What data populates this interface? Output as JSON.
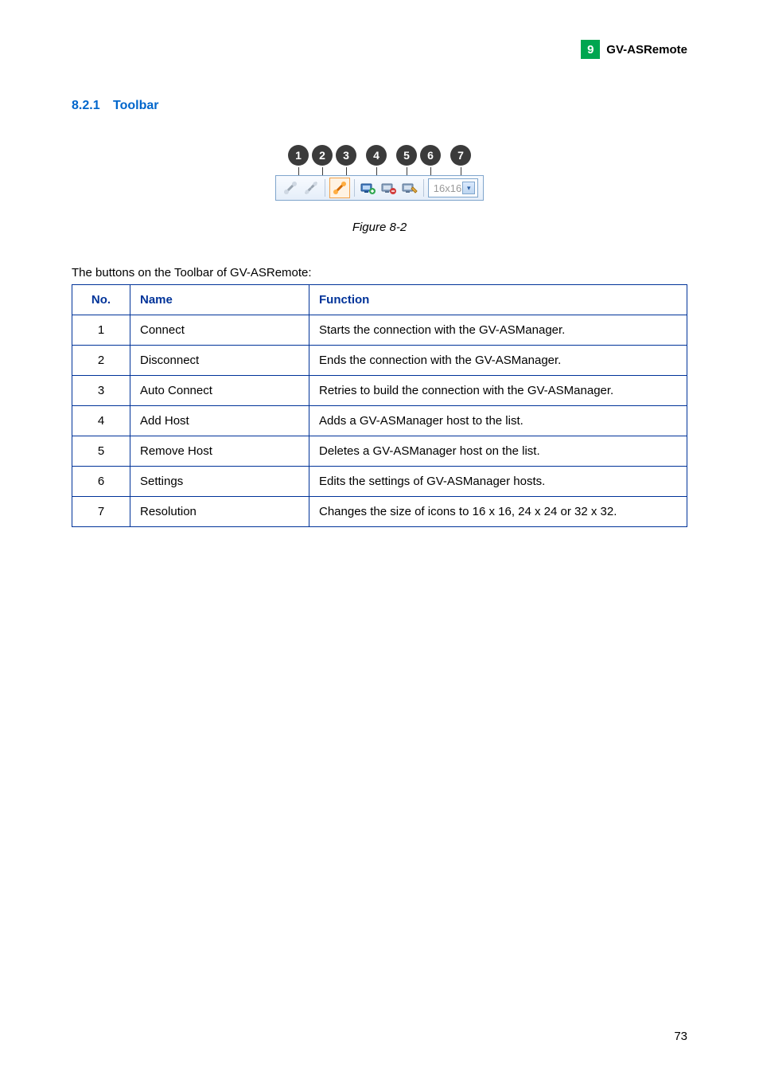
{
  "header": {
    "badge": "9",
    "title": "GV-ASRemote"
  },
  "section": {
    "number": "8.2.1",
    "title": "Toolbar"
  },
  "toolbar": {
    "callouts": [
      "1",
      "2",
      "3",
      "4",
      "5",
      "6",
      "7"
    ],
    "resolution_value": "16x16"
  },
  "figure_caption": "Figure 8-2",
  "table_intro": "The buttons on the Toolbar of GV-ASRemote:",
  "table": {
    "headers": {
      "no": "No.",
      "name": "Name",
      "func": "Function"
    },
    "rows": [
      {
        "no": "1",
        "name": "Connect",
        "func": "Starts the connection with the GV-ASManager."
      },
      {
        "no": "2",
        "name": "Disconnect",
        "func": "Ends the connection with the GV-ASManager."
      },
      {
        "no": "3",
        "name": "Auto Connect",
        "func": "Retries to build the connection with the GV-ASManager."
      },
      {
        "no": "4",
        "name": "Add Host",
        "func": "Adds a GV-ASManager host to the list."
      },
      {
        "no": "5",
        "name": "Remove Host",
        "func": "Deletes a GV-ASManager host on the list."
      },
      {
        "no": "6",
        "name": "Settings",
        "func": "Edits the settings of GV-ASManager hosts."
      },
      {
        "no": "7",
        "name": "Resolution",
        "func": "Changes the size of icons to 16 x 16, 24 x 24 or 32 x 32."
      }
    ]
  },
  "page_number": "73"
}
